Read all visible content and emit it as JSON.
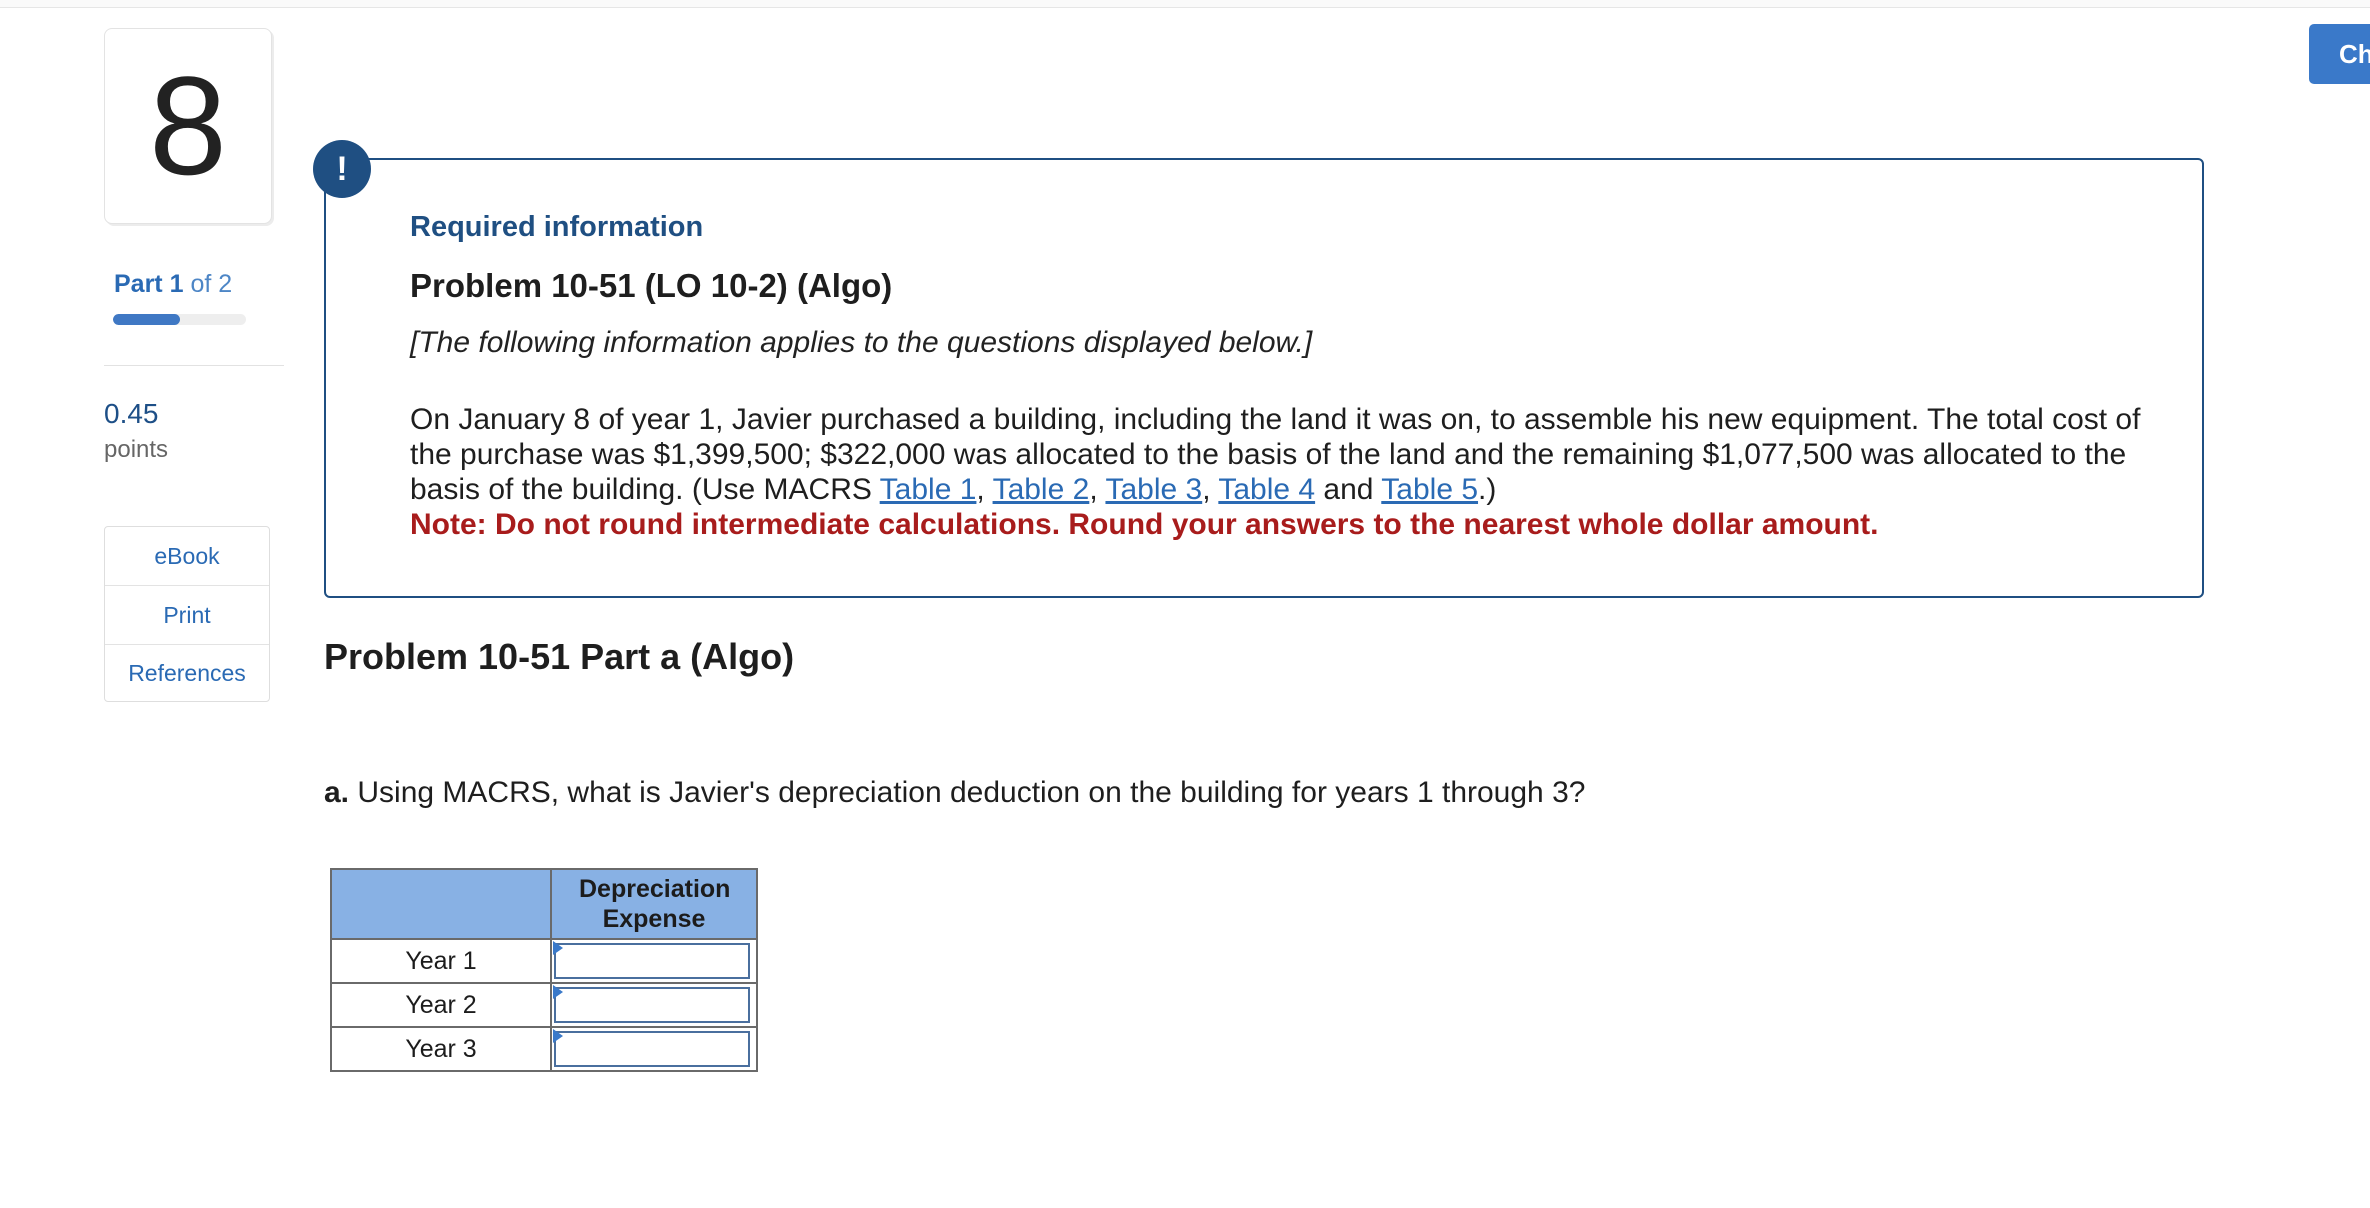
{
  "question": {
    "number": "8",
    "part_current": "Part 1",
    "part_total": "of 2",
    "progress_fraction": 0.5,
    "points_value": "0.45",
    "points_label": "points"
  },
  "tools": {
    "ebook": "eBook",
    "print": "Print",
    "references": "References"
  },
  "header": {
    "check_button": "Ch"
  },
  "required_info": {
    "icon": "!",
    "title": "Required information",
    "problem_title": "Problem 10-51 (LO 10-2) (Algo)",
    "applies": "[The following information applies to the questions displayed below.]",
    "body_part1": "On January 8 of year 1, Javier purchased a building, including the land it was on, to assemble his new equipment. The total cost of the purchase was $1,399,500; $322,000 was allocated to the basis of the land and the remaining $1,077,500 was allocated to the basis of the building. (Use MACRS ",
    "link_table1": "Table 1",
    "sep1": ", ",
    "link_table2": "Table 2",
    "sep2": ", ",
    "link_table3": "Table 3",
    "sep3": ", ",
    "link_table4": "Table 4",
    "and_text": " and ",
    "link_table5": "Table 5",
    "body_end": ".)",
    "note": "Note: Do not round intermediate calculations. Round your answers to the nearest whole dollar amount."
  },
  "part": {
    "title": "Problem 10-51 Part a (Algo)",
    "question_prefix": "a.",
    "question_text": " Using MACRS, what is Javier's depreciation deduction on the building for years 1 through 3?"
  },
  "answer_table": {
    "header_blank": "",
    "header_col": "Depreciation Expense",
    "rows": [
      {
        "label": "Year 1",
        "value": ""
      },
      {
        "label": "Year 2",
        "value": ""
      },
      {
        "label": "Year 3",
        "value": ""
      }
    ]
  }
}
